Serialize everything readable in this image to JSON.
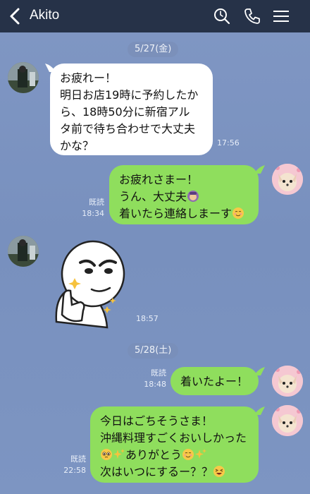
{
  "header": {
    "contact_name": "Akito"
  },
  "dates": [
    "5/27(金)",
    "5/28(土)"
  ],
  "messages": [
    {
      "side": "left",
      "lines": [
        "お疲れー！",
        "明日お店19時に予約したか",
        "ら、18時50分に新宿アル",
        "タ前で待ち合わせで大丈夫",
        "かな？"
      ],
      "time": "17:56"
    },
    {
      "side": "right",
      "lines": [
        "お疲れさまー！",
        "うん、大丈夫",
        "着いたら連絡しまーす"
      ],
      "read": "既読",
      "time": "18:34"
    },
    {
      "side": "left",
      "sticker": "thumbs-up-face-sticker",
      "time": "18:57"
    },
    {
      "side": "right",
      "lines": [
        "着いたよー！"
      ],
      "read": "既読",
      "time": "18:48"
    },
    {
      "side": "right",
      "lines": [
        "今日はごちそうさま！",
        "沖縄料理すごくおいしかった",
        "ありがとう",
        "次はいつにするー？？"
      ],
      "read": "既読",
      "time": "22:58"
    }
  ],
  "colors": {
    "header_bg": "#263248",
    "chat_bg": "#7b93c0",
    "bubble_right": "#8fde5d",
    "bubble_left": "#ffffff"
  }
}
